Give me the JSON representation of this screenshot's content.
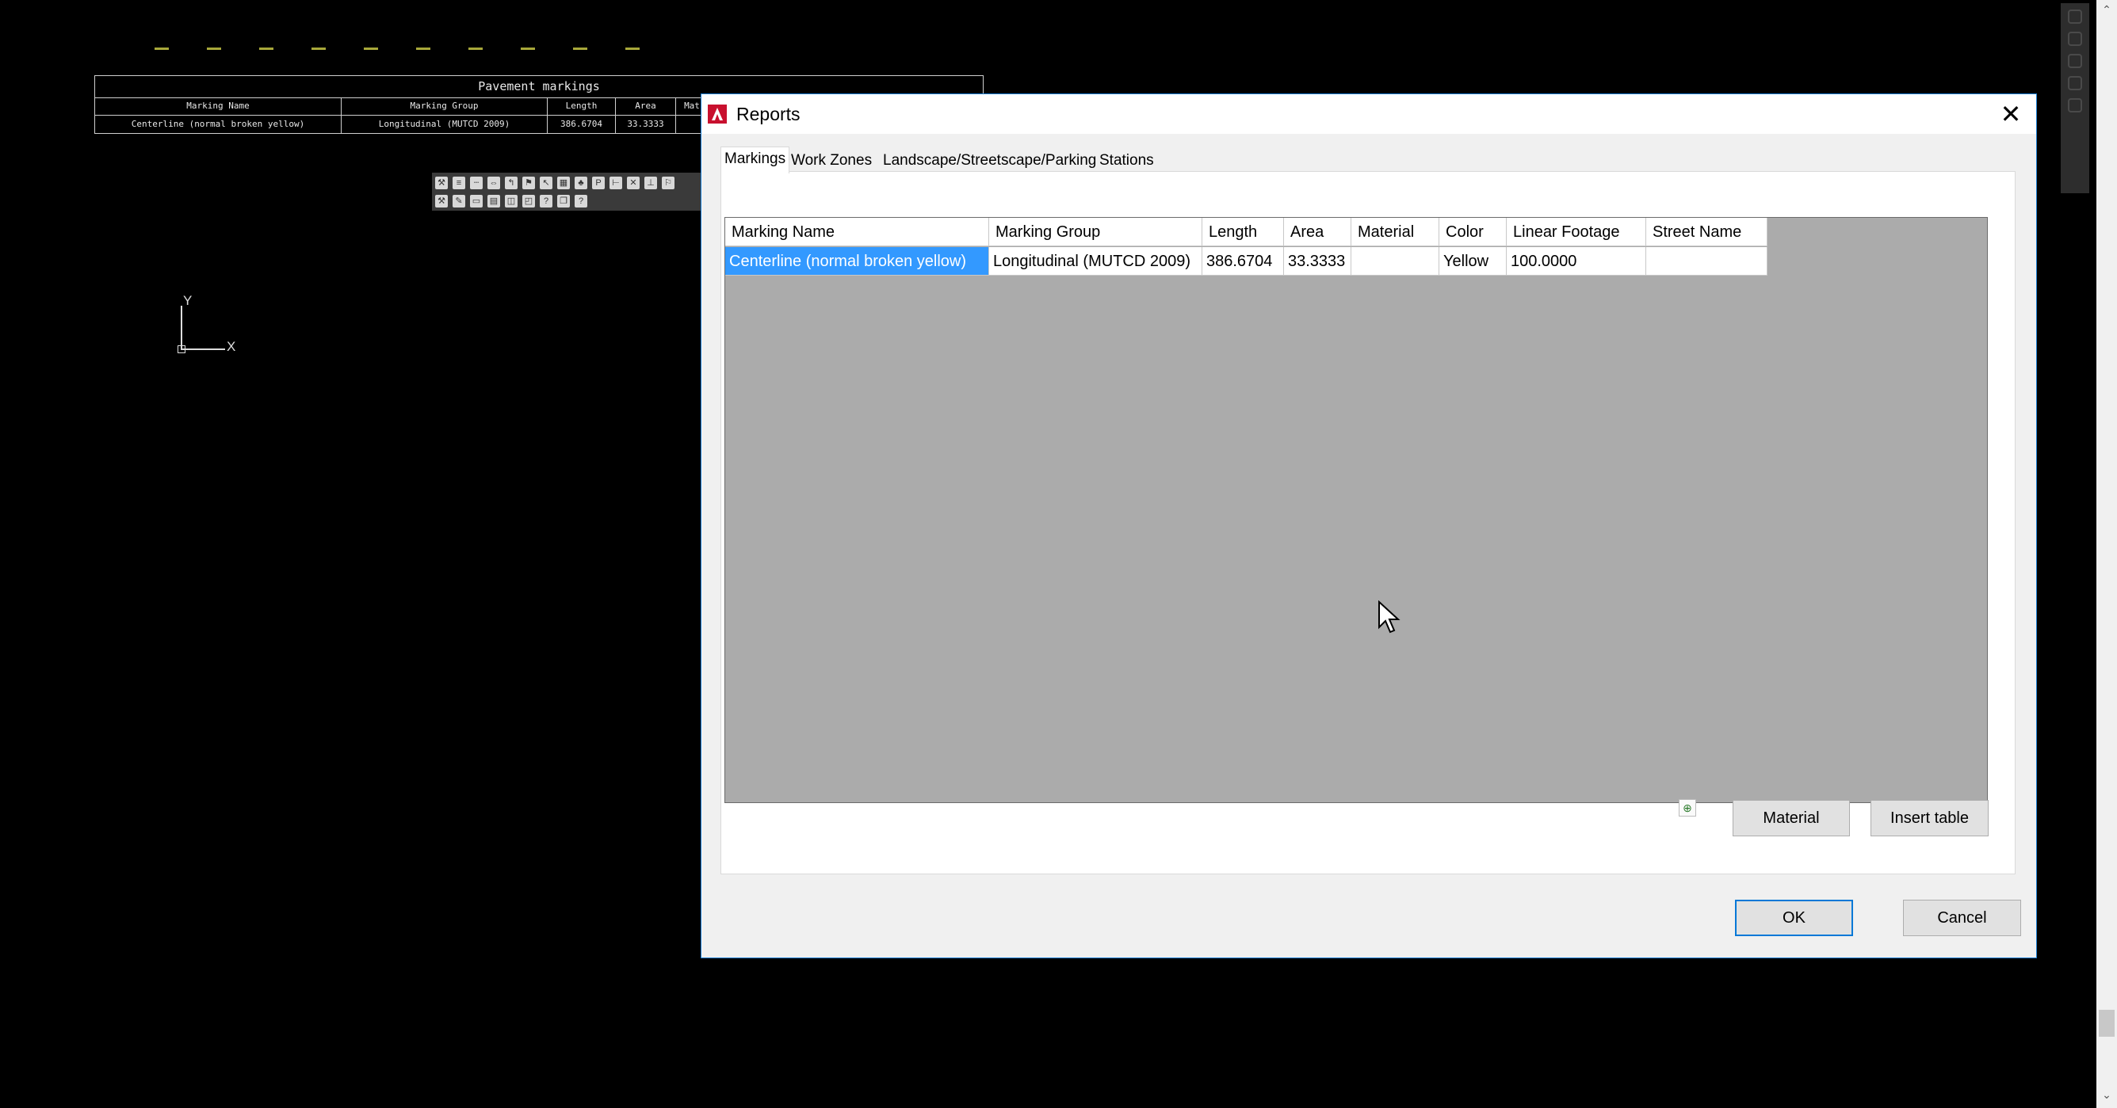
{
  "cad": {
    "table": {
      "title": "Pavement markings",
      "headers": [
        "Marking Name",
        "Marking Group",
        "Length",
        "Area",
        "Mat"
      ],
      "row": [
        "Centerline (normal broken yellow)",
        "Longitudinal (MUTCD 2009)",
        "386.6704",
        "33.3333",
        ""
      ]
    },
    "ucs": {
      "y": "Y",
      "x": "X"
    },
    "dash_color": "#a8a83a"
  },
  "dialog": {
    "title": "Reports",
    "close": "✕",
    "tabs": [
      {
        "label": "Markings"
      },
      {
        "label": "Work Zones"
      },
      {
        "label": "Landscape/Streetscape/Parking"
      },
      {
        "label": "Stations"
      }
    ],
    "grid": {
      "headers": [
        "Marking Name",
        "Marking Group",
        "Length",
        "Area",
        "Material",
        "Color",
        "Linear Footage",
        "Street Name"
      ],
      "rows": [
        [
          "Centerline (normal broken yellow)",
          "Longitudinal (MUTCD 2009)",
          "386.6704",
          "33.3333",
          "",
          "Yellow",
          "100.0000",
          ""
        ]
      ]
    },
    "buttons": {
      "material": "Material",
      "insert_table": "Insert table",
      "ok": "OK",
      "cancel": "Cancel"
    },
    "accent": "#0078d7",
    "selection_color": "#3399ff"
  }
}
